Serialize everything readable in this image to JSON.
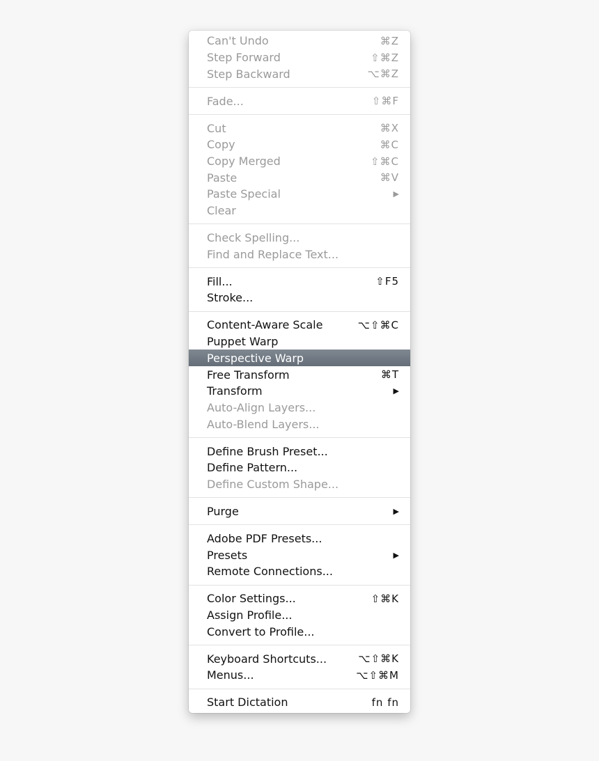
{
  "menu": {
    "sections": [
      [
        {
          "label": "Can't Undo",
          "shortcut": "⌘Z",
          "disabled": true
        },
        {
          "label": "Step Forward",
          "shortcut": "⇧⌘Z",
          "disabled": true
        },
        {
          "label": "Step Backward",
          "shortcut": "⌥⌘Z",
          "disabled": true
        }
      ],
      [
        {
          "label": "Fade...",
          "shortcut": "⇧⌘F",
          "disabled": true
        }
      ],
      [
        {
          "label": "Cut",
          "shortcut": "⌘X",
          "disabled": true
        },
        {
          "label": "Copy",
          "shortcut": "⌘C",
          "disabled": true
        },
        {
          "label": "Copy Merged",
          "shortcut": "⇧⌘C",
          "disabled": true
        },
        {
          "label": "Paste",
          "shortcut": "⌘V",
          "disabled": true
        },
        {
          "label": "Paste Special",
          "submenu": true,
          "disabled": true
        },
        {
          "label": "Clear",
          "disabled": true
        }
      ],
      [
        {
          "label": "Check Spelling...",
          "disabled": true
        },
        {
          "label": "Find and Replace Text...",
          "disabled": true
        }
      ],
      [
        {
          "label": "Fill...",
          "shortcut": "⇧F5"
        },
        {
          "label": "Stroke..."
        }
      ],
      [
        {
          "label": "Content-Aware Scale",
          "shortcut": "⌥⇧⌘C"
        },
        {
          "label": "Puppet Warp"
        },
        {
          "label": "Perspective Warp",
          "highlighted": true
        },
        {
          "label": "Free Transform",
          "shortcut": "⌘T"
        },
        {
          "label": "Transform",
          "submenu": true
        },
        {
          "label": "Auto-Align Layers...",
          "disabled": true
        },
        {
          "label": "Auto-Blend Layers...",
          "disabled": true
        }
      ],
      [
        {
          "label": "Define Brush Preset..."
        },
        {
          "label": "Define Pattern..."
        },
        {
          "label": "Define Custom Shape...",
          "disabled": true
        }
      ],
      [
        {
          "label": "Purge",
          "submenu": true
        }
      ],
      [
        {
          "label": "Adobe PDF Presets..."
        },
        {
          "label": "Presets",
          "submenu": true
        },
        {
          "label": "Remote Connections..."
        }
      ],
      [
        {
          "label": "Color Settings...",
          "shortcut": "⇧⌘K"
        },
        {
          "label": "Assign Profile..."
        },
        {
          "label": "Convert to Profile..."
        }
      ],
      [
        {
          "label": "Keyboard Shortcuts...",
          "shortcut": "⌥⇧⌘K"
        },
        {
          "label": "Menus...",
          "shortcut": "⌥⇧⌘M"
        }
      ],
      [
        {
          "label": "Start Dictation",
          "shortcut": "fn fn"
        }
      ]
    ],
    "submenu_glyph": "▶",
    "highlight_color": "#6f7882"
  }
}
